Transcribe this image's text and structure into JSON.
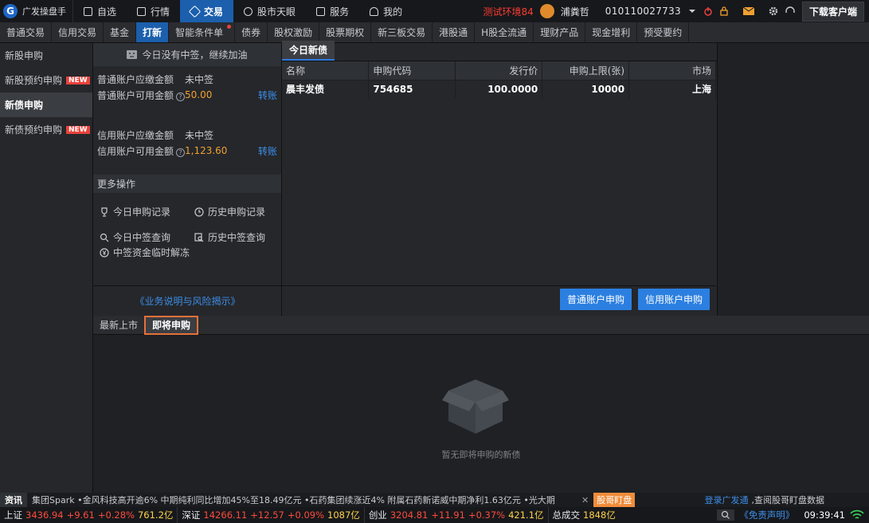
{
  "app": {
    "name": "广发操盘手",
    "env": "测试环境84",
    "user": "浦粪哲",
    "account": "010110027733",
    "download": "下载客户端"
  },
  "nav": [
    {
      "label": "自选",
      "icon": "plus-square-icon",
      "active": false
    },
    {
      "label": "行情",
      "icon": "chart-icon",
      "active": false
    },
    {
      "label": "交易",
      "icon": "gavel-icon",
      "active": true
    },
    {
      "label": "股市天眼",
      "icon": "eye-icon",
      "active": false
    },
    {
      "label": "服务",
      "icon": "briefcase-icon",
      "active": false
    },
    {
      "label": "我的",
      "icon": "person-icon",
      "active": false
    }
  ],
  "tabs": [
    "普通交易",
    "信用交易",
    "基金",
    "打新",
    "智能条件单",
    "债券",
    "股权激励",
    "股票期权",
    "新三板交易",
    "港股通",
    "H股全流通",
    "理财产品",
    "现金增利",
    "预受要约"
  ],
  "active_tab": "打新",
  "sidebar": [
    {
      "label": "新股申购",
      "badge": ""
    },
    {
      "label": "新股预约申购",
      "badge": "NEW"
    },
    {
      "label": "新债申购",
      "badge": ""
    },
    {
      "label": "新债预约申购",
      "badge": "NEW"
    }
  ],
  "panel": {
    "banner": "今日没有中签，继续加油",
    "normal_due_label": "普通账户应缴金额",
    "normal_due_value": "未中签",
    "normal_avail_label": "普通账户可用金额",
    "normal_avail_value": "50.00",
    "transfer": "转账",
    "credit_due_label": "信用账户应缴金额",
    "credit_due_value": "未中签",
    "credit_avail_label": "信用账户可用金额",
    "credit_avail_value": "1,123.60",
    "more": "更多操作",
    "ops": [
      "今日申购记录",
      "历史申购记录",
      "今日中签查询",
      "历史中签查询",
      "中签资金临时解冻"
    ],
    "biz_link": "《业务说明与风险揭示》"
  },
  "bonds": {
    "tab": "今日新债",
    "headers": [
      "名称",
      "申购代码",
      "发行价",
      "申购上限(张)",
      "市场"
    ],
    "rows": [
      [
        "晨丰发债",
        "754685",
        "100.0000",
        "10000",
        "上海"
      ]
    ],
    "btn_normal": "普通账户申购",
    "btn_credit": "信用账户申购"
  },
  "lower": {
    "tabs": [
      "最新上市",
      "即将申购"
    ],
    "active": "即将申购",
    "empty": "暂无即将申购的新债"
  },
  "ticker": {
    "label": "资讯",
    "news": "集团Spark  •金风科技高开逾6% 中期纯利同比增加45%至18.49亿元  •石药集团续涨近4% 附属石药新诺威中期净利1.63亿元  •光大期",
    "close": "✕",
    "gg": "股哥盯盘",
    "login": "登录广发通",
    "desc": ",查阅股哥盯盘数据"
  },
  "status": {
    "sh": {
      "name": "上证",
      "price": "3436.94",
      "chg": "+9.61",
      "pct": "+0.28%",
      "vol": "761.2亿"
    },
    "sz": {
      "name": "深证",
      "price": "14266.11",
      "chg": "+12.57",
      "pct": "+0.09%",
      "vol": "1087亿"
    },
    "cy": {
      "name": "创业",
      "price": "3204.81",
      "chg": "+11.91",
      "pct": "+0.37%",
      "vol": "421.1亿"
    },
    "total_label": "总成交",
    "total": "1848亿",
    "disclaimer": "《免责声明》",
    "time": "09:39:41"
  }
}
